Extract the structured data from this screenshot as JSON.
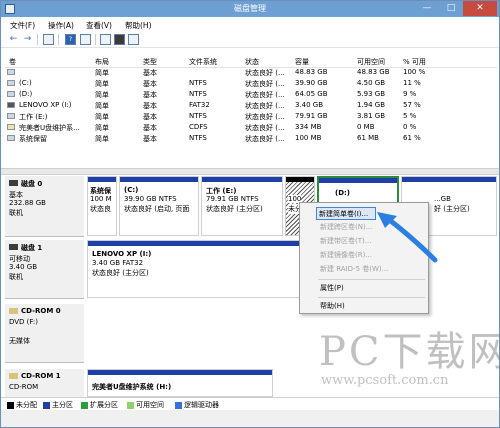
{
  "window": {
    "title": "磁盘管理",
    "minimize": "—",
    "maximize": "□",
    "close": "✕"
  },
  "menu": [
    "文件(F)",
    "操作(A)",
    "查看(V)",
    "帮助(H)"
  ],
  "toolbar": {
    "back": "←",
    "forward": "→",
    "help": "?"
  },
  "columns": [
    "卷",
    "布局",
    "类型",
    "文件系统",
    "状态",
    "容量",
    "可用空间",
    "% 可用"
  ],
  "volumes": [
    {
      "name": "",
      "layout": "简单",
      "type": "基本",
      "fs": "",
      "status": "状态良好 (...",
      "capacity": "48.83 GB",
      "free": "48.83 GB",
      "pct": "100 %"
    },
    {
      "name": "(C:)",
      "layout": "简单",
      "type": "基本",
      "fs": "NTFS",
      "status": "状态良好 (...",
      "capacity": "39.90 GB",
      "free": "4.50 GB",
      "pct": "11 %"
    },
    {
      "name": "(D:)",
      "layout": "简单",
      "type": "基本",
      "fs": "NTFS",
      "status": "状态良好 (...",
      "capacity": "64.05 GB",
      "free": "5.93 GB",
      "pct": "9 %"
    },
    {
      "name": "LENOVO XP (I:)",
      "layout": "简单",
      "type": "基本",
      "fs": "FAT32",
      "status": "状态良好 (...",
      "capacity": "3.40 GB",
      "free": "1.94 GB",
      "pct": "57 %"
    },
    {
      "name": "工作 (E:)",
      "layout": "简单",
      "type": "基本",
      "fs": "NTFS",
      "status": "状态良好 (...",
      "capacity": "79.91 GB",
      "free": "3.81 GB",
      "pct": "5 %"
    },
    {
      "name": "完美者U盘维护系...",
      "layout": "简单",
      "type": "基本",
      "fs": "CDFS",
      "status": "状态良好 (...",
      "capacity": "334 MB",
      "free": "0 MB",
      "pct": "0 %"
    },
    {
      "name": "系统保留",
      "layout": "简单",
      "type": "基本",
      "fs": "NTFS",
      "status": "状态良好 (...",
      "capacity": "100 MB",
      "free": "61 MB",
      "pct": "61 %"
    }
  ],
  "disks": [
    {
      "label": "磁盘 0",
      "kind": "基本",
      "size": "232.88 GB",
      "state": "联机",
      "parts": [
        {
          "name": "系统保",
          "size": "100 M",
          "status": "状态良"
        },
        {
          "name": "(C:)",
          "size": "39.90 GB NTFS",
          "status": "状态良好 (启动, 页面"
        },
        {
          "name": "工作  (E:)",
          "size": "79.91 GB NTFS",
          "status": "状态良好 (主分区)"
        },
        {
          "name": "",
          "size": "100",
          "status": "未分"
        },
        {
          "name": "(D:)",
          "size": "",
          "status": ""
        },
        {
          "name": "",
          "size": "...GB",
          "status": "好 (主分区)"
        }
      ]
    },
    {
      "label": "磁盘 1",
      "kind": "可移动",
      "size": "3.40 GB",
      "state": "联机",
      "parts": [
        {
          "name": "LENOVO XP  (I:)",
          "size": "3.40 GB FAT32",
          "status": "状态良好 (主分区)"
        }
      ]
    },
    {
      "label": "CD-ROM 0",
      "kind": "DVD (F:)",
      "size": "",
      "state": "无媒体",
      "parts": []
    },
    {
      "label": "CD-ROM 1",
      "kind": "CD-ROM",
      "size": "",
      "state": "",
      "parts": [
        {
          "name": "完美者U盘维护系统  (H:)",
          "size": "",
          "status": ""
        }
      ]
    }
  ],
  "context_menu": [
    {
      "label": "新建简单卷(I)...",
      "enabled": true
    },
    {
      "label": "新建跨区卷(N)...",
      "enabled": false
    },
    {
      "label": "新建带区卷(T)...",
      "enabled": false
    },
    {
      "label": "新建镜像卷(R)...",
      "enabled": false
    },
    {
      "label": "新建 RAID-5 卷(W)...",
      "enabled": false
    },
    {
      "label": "属性(P)",
      "enabled": true
    },
    {
      "label": "帮助(H)",
      "enabled": true
    }
  ],
  "legend": [
    {
      "label": "未分配",
      "color": "#000000"
    },
    {
      "label": "主分区",
      "color": "#1f3fa8"
    },
    {
      "label": "扩展分区",
      "color": "#2e9e3a"
    },
    {
      "label": "可用空间",
      "color": "#8fd16f"
    },
    {
      "label": "逻辑驱动器",
      "color": "#3c6ed8"
    }
  ],
  "watermark": {
    "big": "PC下载网",
    "url": "www.pcsoft.com.cn"
  },
  "colors": {
    "primary": "#1f3fa8",
    "unallocated": "#000000",
    "free": "#8fd16f",
    "highlight": "#3f86d6"
  }
}
